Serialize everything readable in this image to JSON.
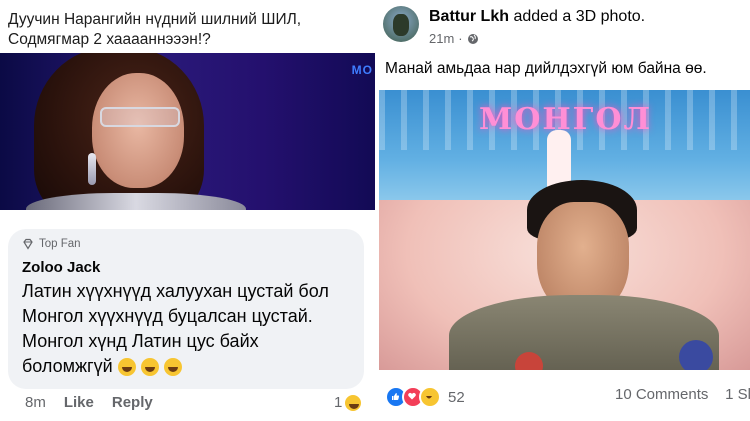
{
  "left_post": {
    "caption_line1": "Дуучин Нарангийн нүдний шилний ШИЛ,",
    "caption_line2": "Содмягмар 2 хааааннэээн!?",
    "photo_logo": "МО",
    "comment": {
      "badge": "Top Fan",
      "author": "Zoloo Jack",
      "lines": [
        "Латин хүүхнүүд халуухан цустай бол",
        "Монгол хүүхнүүд буцалсан цустай.",
        "Монгол хүнд Латин цус байх",
        "боломжгүй"
      ],
      "time": "8m",
      "like_label": "Like",
      "reply_label": "Reply",
      "reaction_count": "1"
    }
  },
  "right_post": {
    "poster_name": "Battur Lkh",
    "poster_action": "added a 3D photo.",
    "time": "21m",
    "text": "Манай амьдаа нар дийлдэхгүй юм байна өө.",
    "photo_sign": "МОНГОЛ",
    "reaction_count": "52",
    "comments_label": "10 Comments",
    "shares_label": "1 Sl"
  },
  "colors": {
    "like": "#1877f2",
    "love": "#f33e58",
    "haha": "#f7c531",
    "secondary_text": "#65676b",
    "bubble": "#f0f2f5"
  }
}
